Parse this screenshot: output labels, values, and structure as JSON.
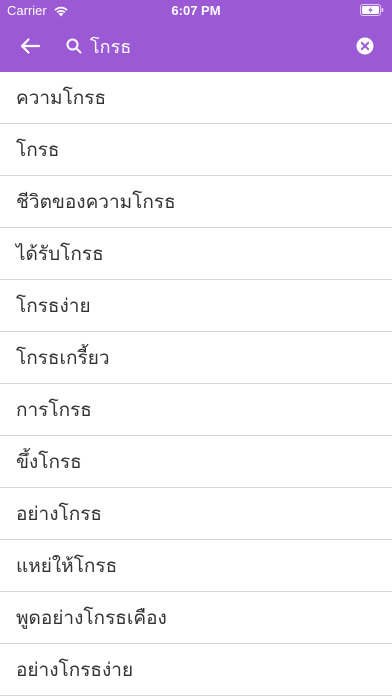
{
  "status_bar": {
    "carrier": "Carrier",
    "time": "6:07 PM",
    "wifi_icon": "wifi-icon",
    "battery_icon": "battery-charging-icon"
  },
  "search": {
    "value": "โกรธ",
    "placeholder": "",
    "back_icon": "arrow-left-icon",
    "search_icon": "search-icon",
    "clear_icon": "clear-circle-icon"
  },
  "colors": {
    "accent": "#9c59d6",
    "text": "#333333",
    "divider": "#d6d6d6"
  },
  "results": [
    "ความโกรธ",
    "โกรธ",
    "ชีวิตของความโกรธ",
    "ได้รับโกรธ",
    "โกรธง่าย",
    "โกรธเกรี้ยว",
    "การโกรธ",
    "ขึ้งโกรธ",
    "อย่างโกรธ",
    "แหย่ให้โกรธ",
    "พูดอย่างโกรธเคือง",
    "อย่างโกรธง่าย"
  ]
}
